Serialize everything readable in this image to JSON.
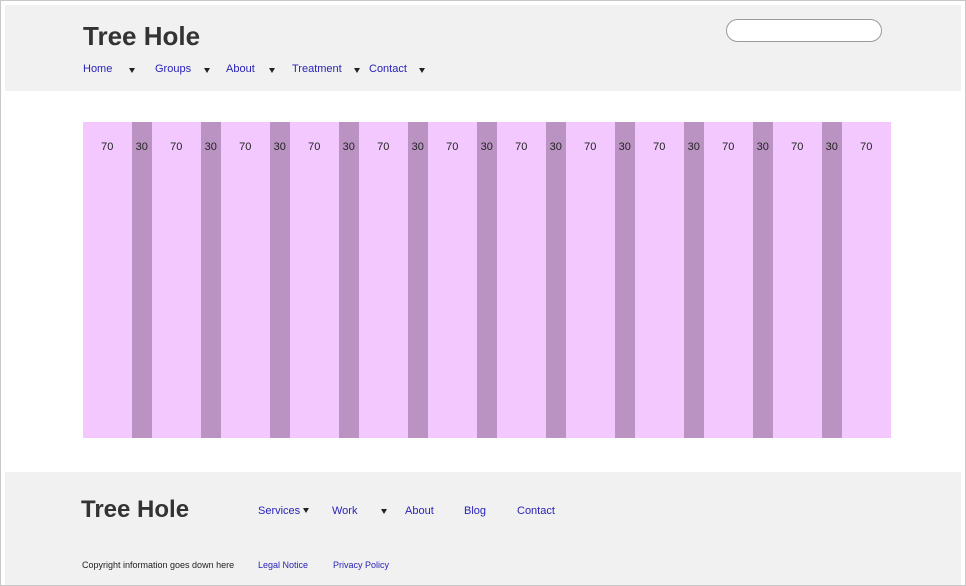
{
  "header": {
    "logo": "Tree Hole",
    "search": {
      "value": "",
      "placeholder": ""
    },
    "nav": [
      {
        "label": "Home",
        "has_dropdown": true
      },
      {
        "label": "Groups",
        "has_dropdown": true
      },
      {
        "label": "About",
        "has_dropdown": true
      },
      {
        "label": "Treatment",
        "has_dropdown": true
      },
      {
        "label": "Contact",
        "has_dropdown": true
      }
    ]
  },
  "grid": {
    "columns": [
      "70",
      "30",
      "70",
      "30",
      "70",
      "30",
      "70",
      "30",
      "70",
      "30",
      "70",
      "30",
      "70",
      "30",
      "70",
      "30",
      "70",
      "30",
      "70",
      "30",
      "70",
      "30",
      "70"
    ],
    "colors": {
      "wide": "#f3c8ff",
      "narrow": "#bb93c3"
    }
  },
  "footer": {
    "logo": "Tree Hole",
    "nav": [
      {
        "label": "Services",
        "has_dropdown": true
      },
      {
        "label": "Work",
        "has_dropdown": true
      },
      {
        "label": "About",
        "has_dropdown": false
      },
      {
        "label": "Blog",
        "has_dropdown": false
      },
      {
        "label": "Contact",
        "has_dropdown": false
      }
    ],
    "copyright": "Copyright information goes down here",
    "links": [
      "Legal Notice",
      "Privacy Policy"
    ]
  },
  "colors": {
    "link": "#2a23b8",
    "bar_background": "#f1f1f1",
    "text": "#333333"
  }
}
